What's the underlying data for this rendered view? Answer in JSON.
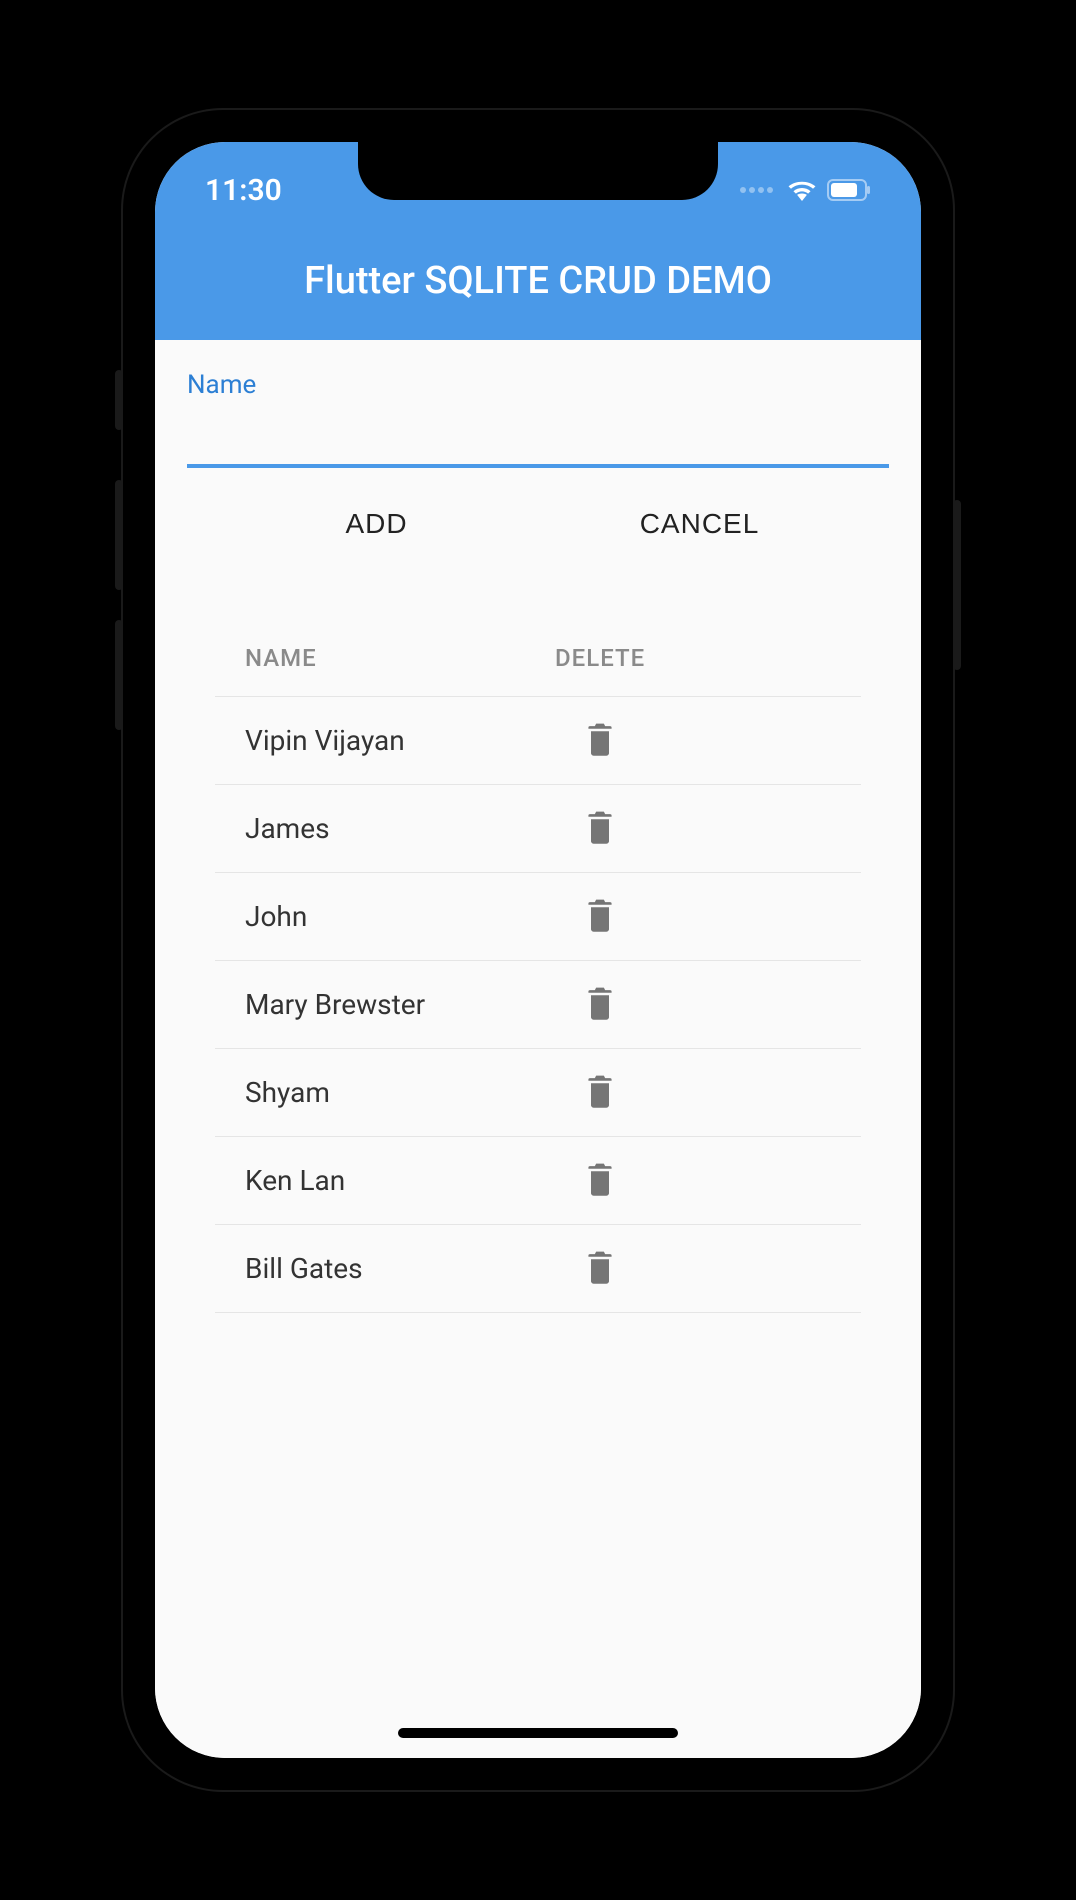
{
  "status": {
    "time": "11:30"
  },
  "app": {
    "title": "Flutter SQLITE CRUD DEMO"
  },
  "form": {
    "label": "Name",
    "add_label": "ADD",
    "cancel_label": "CANCEL"
  },
  "table": {
    "header_name": "NAME",
    "header_delete": "DELETE",
    "rows": [
      {
        "name": "Vipin Vijayan"
      },
      {
        "name": "James"
      },
      {
        "name": "John"
      },
      {
        "name": "Mary Brewster"
      },
      {
        "name": "Shyam"
      },
      {
        "name": "Ken Lan"
      },
      {
        "name": "Bill Gates"
      }
    ]
  }
}
